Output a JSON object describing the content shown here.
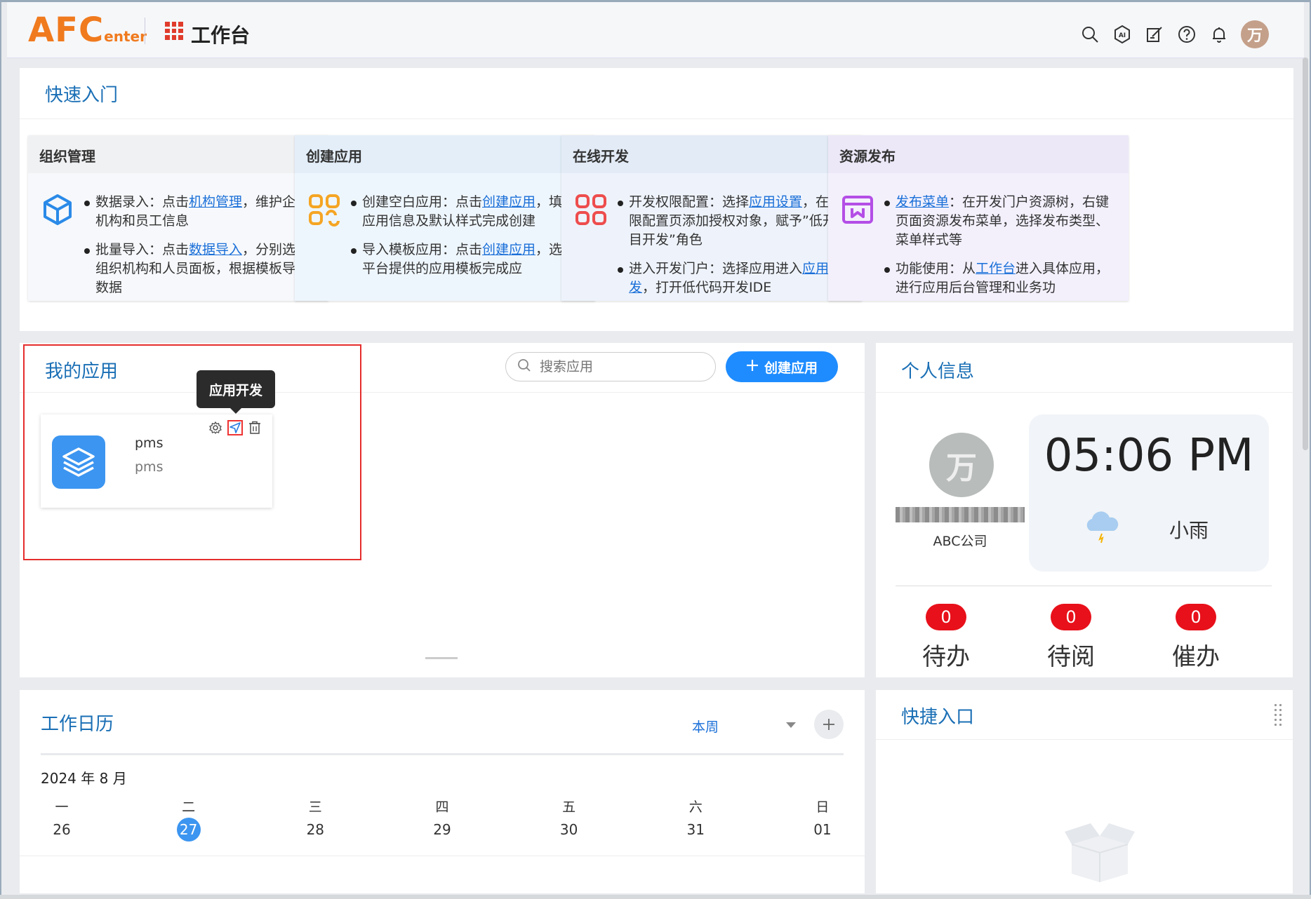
{
  "header": {
    "logo_main": "AFC",
    "logo_sub": "enter",
    "title": "工作台",
    "avatar_char": "万",
    "icons": [
      "search-icon",
      "ai-icon",
      "edit-icon",
      "help-icon",
      "bell-icon"
    ]
  },
  "quick_entry": {
    "title": "快速入门",
    "cards": [
      {
        "title": "组织管理",
        "icon": "cube-icon",
        "items": [
          {
            "pre": "数据录入：点击",
            "link": "机构管理",
            "post": "，维护企业机构和员工信息"
          },
          {
            "pre": "批量导入：点击",
            "link": "数据导入",
            "post": "，分别选择组织机构和人员面板，根据模板导入数据"
          }
        ]
      },
      {
        "title": "创建应用",
        "icon": "apps-icon",
        "items": [
          {
            "pre": "创建空白应用：点击",
            "link": "创建应用",
            "post": "，填写应用信息及默认样式完成创建"
          },
          {
            "pre": "导入模板应用：点击",
            "link": "创建应用",
            "post": "，选择平台提供的应用模板完成应"
          }
        ]
      },
      {
        "title": "在线开发",
        "icon": "dev-grid-icon",
        "items": [
          {
            "pre": "开发权限配置：选择",
            "link": "应用设置",
            "post": "，在权限配置页添加授权对象，赋予”低开项目开发”角色"
          },
          {
            "pre": "进入开发门户：选择应用进入",
            "link": "应用开发",
            "post": "，打开低代码开发IDE"
          }
        ]
      },
      {
        "title": "资源发布",
        "icon": "publish-icon",
        "items": [
          {
            "pre": "",
            "link": "发布菜单",
            "post": "：在开发门户资源树，右键页面资源发布菜单，选择发布类型、菜单样式等"
          },
          {
            "pre": "功能使用：从",
            "link": "工作台",
            "post": "进入具体应用，进行应用后台管理和业务功"
          }
        ]
      }
    ]
  },
  "my_apps": {
    "title": "我的应用",
    "search_placeholder": "搜索应用",
    "create_label": "创建应用",
    "tooltip": "应用开发",
    "apps": [
      {
        "name": "pms",
        "code": "pms"
      }
    ]
  },
  "personal": {
    "title": "个人信息",
    "avatar_char": "万",
    "company": "ABC公司",
    "time": "05:06 PM",
    "weather": "小雨",
    "counters": [
      {
        "count": "0",
        "label": "待办"
      },
      {
        "count": "0",
        "label": "待阅"
      },
      {
        "count": "0",
        "label": "催办"
      }
    ]
  },
  "calendar": {
    "title": "工作日历",
    "range": "本周",
    "month": "2024 年 8 月",
    "days": [
      {
        "weekday": "一",
        "date": "26"
      },
      {
        "weekday": "二",
        "date": "27",
        "today": true
      },
      {
        "weekday": "三",
        "date": "28"
      },
      {
        "weekday": "四",
        "date": "29"
      },
      {
        "weekday": "五",
        "date": "30"
      },
      {
        "weekday": "六",
        "date": "31"
      },
      {
        "weekday": "日",
        "date": "01"
      }
    ]
  },
  "quick_links": {
    "title": "快捷入口"
  },
  "colors": {
    "accent": "#1e8cff",
    "title_blue": "#1a6fb5",
    "badge_red": "#e8101a",
    "logo_orange": "#f07a1e"
  }
}
